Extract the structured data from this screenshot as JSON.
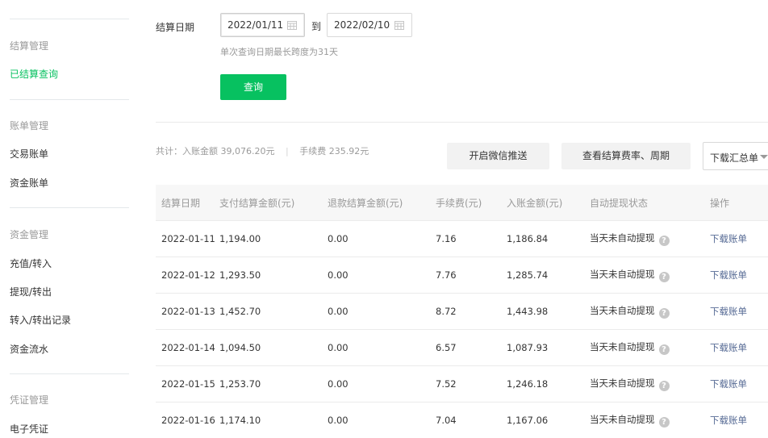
{
  "sidebar": {
    "groups": [
      {
        "title": "结算管理",
        "items": [
          {
            "label": "已结算查询",
            "active": true
          }
        ]
      },
      {
        "title": "账单管理",
        "items": [
          {
            "label": "交易账单"
          },
          {
            "label": "资金账单"
          }
        ]
      },
      {
        "title": "资金管理",
        "items": [
          {
            "label": "充值/转入"
          },
          {
            "label": "提现/转出"
          },
          {
            "label": "转入/转出记录"
          },
          {
            "label": "资金流水"
          }
        ]
      },
      {
        "title": "凭证管理",
        "items": [
          {
            "label": "电子凭证"
          }
        ]
      }
    ]
  },
  "filter": {
    "label": "结算日期",
    "start_date": "2022/01/11",
    "separator": "到",
    "end_date": "2022/02/10",
    "hint": "单次查询日期最长跨度为31天",
    "query_button": "查询"
  },
  "summary": {
    "text": "共计：入账金额 39,076.20元",
    "divider": "|",
    "fee": "手续费 235.92元"
  },
  "actions": {
    "wechat_push": "开启微信推送",
    "view_rate": "查看结算费率、周期",
    "download_summary": "下载汇总单"
  },
  "table": {
    "headers": [
      "结算日期",
      "支付结算金额(元)",
      "退款结算金额(元)",
      "手续费(元)",
      "入账金额(元)",
      "自动提现状态",
      "操作"
    ],
    "rows": [
      {
        "date": "2022-01-11",
        "pay": "1,194.00",
        "refund": "0.00",
        "fee": "7.16",
        "credit": "1,186.84",
        "status": "当天未自动提现",
        "action": "下载账单"
      },
      {
        "date": "2022-01-12",
        "pay": "1,293.50",
        "refund": "0.00",
        "fee": "7.76",
        "credit": "1,285.74",
        "status": "当天未自动提现",
        "action": "下载账单"
      },
      {
        "date": "2022-01-13",
        "pay": "1,452.70",
        "refund": "0.00",
        "fee": "8.72",
        "credit": "1,443.98",
        "status": "当天未自动提现",
        "action": "下载账单"
      },
      {
        "date": "2022-01-14",
        "pay": "1,094.50",
        "refund": "0.00",
        "fee": "6.57",
        "credit": "1,087.93",
        "status": "当天未自动提现",
        "action": "下载账单"
      },
      {
        "date": "2022-01-15",
        "pay": "1,253.70",
        "refund": "0.00",
        "fee": "7.52",
        "credit": "1,246.18",
        "status": "当天未自动提现",
        "action": "下载账单"
      },
      {
        "date": "2022-01-16",
        "pay": "1,174.10",
        "refund": "0.00",
        "fee": "7.04",
        "credit": "1,167.06",
        "status": "当天未自动提现",
        "action": "下载账单"
      }
    ]
  },
  "colors": {
    "accent": "#07c160",
    "link": "#576b95"
  }
}
